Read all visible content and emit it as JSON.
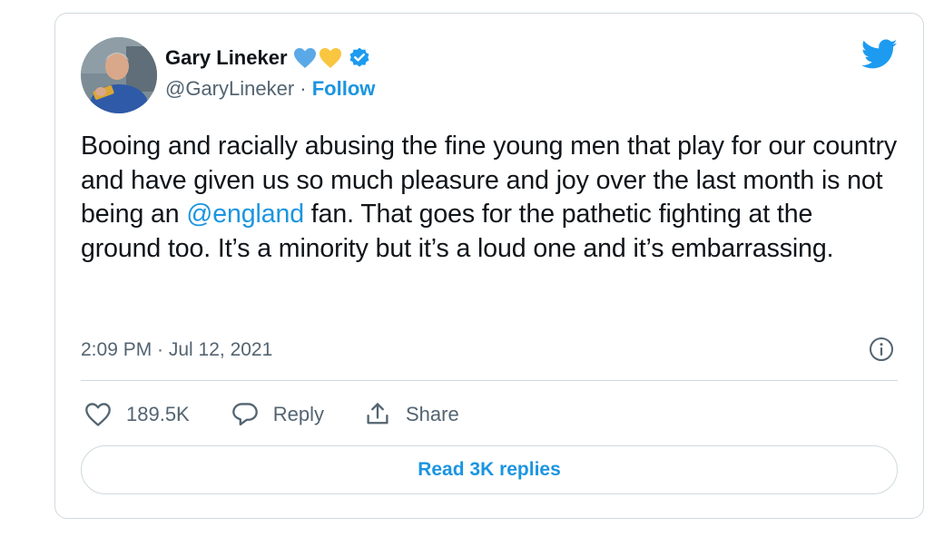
{
  "author": {
    "name": "Gary Lineker",
    "handle": "@GaryLineker",
    "separator": " · ",
    "follow_label": "Follow",
    "avatar_icon": "profile-photo",
    "badges": [
      "blue-heart-icon",
      "yellow-heart-icon",
      "verified-badge-icon"
    ]
  },
  "tweet": {
    "text_before_mention": "Booing and racially abusing the fine young men that play for our country and have given us so much pleasure and joy over the last month is not being an ",
    "mention": "@england",
    "text_after_mention": " fan. That goes for the pathetic fighting at the ground too. It’s a minority but it’s a loud one and it’s embarrassing.",
    "timestamp": "2:09 PM · Jul 12, 2021"
  },
  "actions": {
    "like_count": "189.5K",
    "reply_label": "Reply",
    "share_label": "Share",
    "read_replies_label": "Read 3K replies"
  },
  "icons": {
    "logo": "twitter-bird-icon",
    "info": "info-icon",
    "like": "heart-outline-icon",
    "reply": "speech-bubble-icon",
    "share": "share-upload-icon"
  },
  "colors": {
    "accent": "#1b95e0",
    "text": "#0f1419",
    "secondary": "#536471",
    "border": "#cfd9de",
    "blue_heart": "#5aa9e6",
    "yellow_heart": "#f9c640",
    "verified": "#1d9bf0"
  }
}
